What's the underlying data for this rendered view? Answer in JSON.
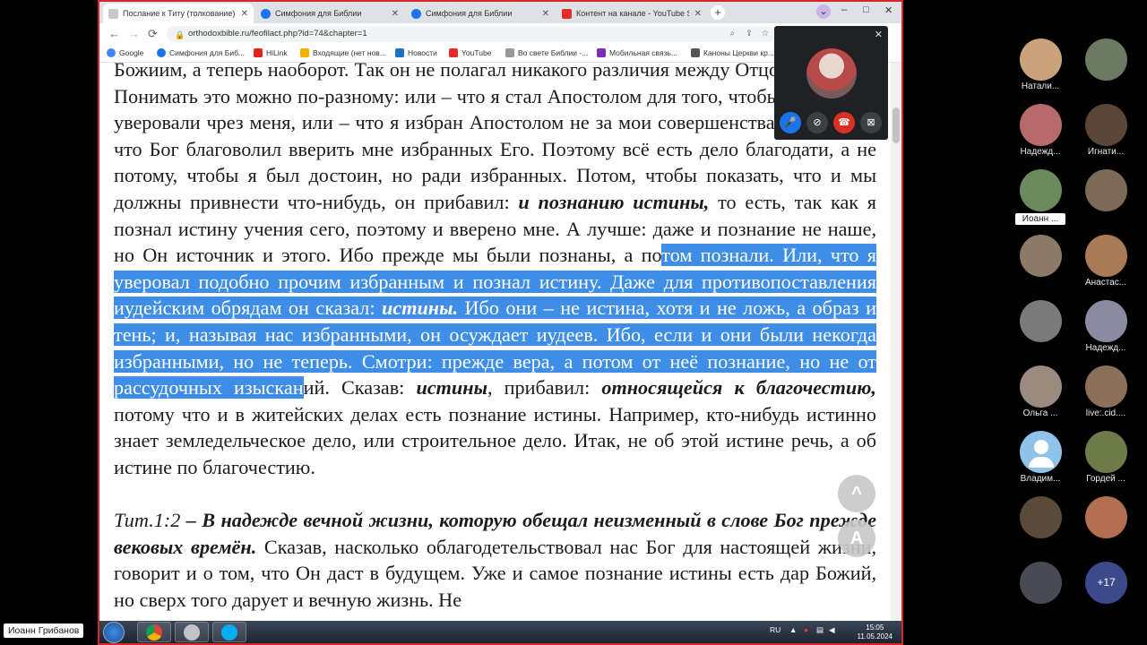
{
  "tabs": [
    {
      "label": "Послание к Титу (толкование).",
      "icon_color": "#c8c8c8",
      "active": true
    },
    {
      "label": "Симфония для Библии",
      "icon_color": "#1a73e8",
      "active": false
    },
    {
      "label": "Симфония для Библии",
      "icon_color": "#1a73e8",
      "active": false
    },
    {
      "label": "Контент на канале - YouTube St",
      "icon_color": "#e52d27",
      "active": false
    }
  ],
  "new_tab_label": "+",
  "window_controls": {
    "min": "–",
    "max": "□",
    "close": "✕"
  },
  "nav": {
    "back": "←",
    "forward": "→",
    "reload": "⟳",
    "url": "orthodoxbible.ru/feofilact.php?id=74&chapter=1",
    "lock": "🔒"
  },
  "bookmarks": [
    {
      "label": "Google",
      "color": "#4285f4"
    },
    {
      "label": "Симфония для Биб...",
      "color": "#1a73e8"
    },
    {
      "label": "HiLink",
      "color": "#e2231a"
    },
    {
      "label": "Входящие (нет нов...",
      "color": "#f0b400"
    },
    {
      "label": "Новости",
      "color": "#1f71c5"
    },
    {
      "label": "YouTube",
      "color": "#e52d27"
    },
    {
      "label": "Во свете Библии -...",
      "color": "#999999"
    },
    {
      "label": "Мобильная связь...",
      "color": "#7b2fb5"
    },
    {
      "label": "Каноны Церкви кр...",
      "color": "#555555"
    }
  ],
  "article": {
    "p1": {
      "t1": "Божиим, а теперь наоборот. Так он не полагал никакого различия между Отцом и Сыном. Понимать это можно по-разному: или – что я стал Апостолом для того, чтобы избранные уверовали чрез меня, или – что я избран Апостолом не за мои совершенства, но потому, что Бог благоволил вверить мне избранных Его. Поэтому всё есть дело благодати, а не потому, чтобы я был достоин, но ради избранных. Потом, чтобы показать, что и мы должны привнести что-нибудь, он прибавил: ",
      "b1": "и познанию истины,",
      "t2": " то есть, так как я познал истину учения сего, поэтому и вверено мне. А лучше: даже и познание не наше, но Он источник и этого. Ибо прежде мы были познаны, а по",
      "s1": "том познали. Или, что я уверовал подобно прочим избранным и познал истину. Даже для противопоставления иудейским обрядам он сказал: ",
      "sb1": "истины.",
      "s2": " Ибо они – не истина, хотя и не ложь, а образ и тень; и, называя нас избранными, он осуждает иудеев. Ибо, если и они были некогда избранными, но не теперь. Смотри: прежде вера, а потом от неё познание, но не от рассудочных изыскан",
      "t3": "ий. Сказав: ",
      "b2": "истины",
      "t4": ", прибавил: ",
      "b3": "относящейся к благочестию,",
      "t5": " потому что и в житейских делах есть познание истины. Например, кто-нибудь истинно знает земледельческое дело, или строительное дело. Итак, не об этой истине речь, а об истине по благочестию."
    },
    "p2": {
      "ref": "Тит.1:2",
      "verse": " – В надежде вечной жизни, которую обещал неизменный в слове Бог прежде вековых времён.",
      "t1": " Сказав, насколько облагодетельствовал нас Бог для настоящей жизни, говорит и о том, что Он даст в будущем. Уже и самое познание истины есть дар Божий, но сверх того дарует и вечную жизнь. Не"
    }
  },
  "float_buttons": {
    "up": "^",
    "font": "A"
  },
  "video_popup": {
    "close": "✕",
    "buttons": [
      {
        "icon": "mic",
        "glyph": "🎤",
        "color": "#1a73e8"
      },
      {
        "icon": "camera-off",
        "glyph": "⊘",
        "color": "#3c4043"
      },
      {
        "icon": "hangup",
        "glyph": "☎",
        "color": "#d93025"
      },
      {
        "icon": "present-stop",
        "glyph": "⊠",
        "color": "#3c4043"
      }
    ]
  },
  "taskbar": {
    "lang": "RU",
    "time": "15:05",
    "date": "11.05.2024"
  },
  "participants": [
    {
      "name": "Натали...",
      "color": "#c9a37c"
    },
    {
      "name": "",
      "color": "#6b7b63"
    },
    {
      "name": "Надежд...",
      "color": "#b66a6a"
    },
    {
      "name": "Игнати...",
      "color": "#5a4637"
    },
    {
      "name": "Иоанн ...",
      "color": "#6c8b5c"
    },
    {
      "name": "",
      "color": "#7b6a55"
    },
    {
      "name": "",
      "color": "#8b7a66"
    },
    {
      "name": "Анастас...",
      "color": "#a87a55"
    },
    {
      "name": "",
      "color": "#7a7a7a"
    },
    {
      "name": "Надежд...",
      "color": "#8a8aa0"
    },
    {
      "name": "Ольга ...",
      "color": "#9a8a80"
    },
    {
      "name": "live:.cid....",
      "color": "#8a7058"
    },
    {
      "name": "Владим...",
      "color": "#8fc3ea"
    },
    {
      "name": "Гордей ...",
      "color": "#6d7a4a"
    },
    {
      "name": "",
      "color": "#5a4a3a"
    },
    {
      "name": "",
      "color": "#b27050"
    },
    {
      "name": "",
      "color": "#4a4a55"
    },
    {
      "name": "+17",
      "color": "#3c4a8c"
    }
  ],
  "self_name": "Иоанн Грибанов"
}
